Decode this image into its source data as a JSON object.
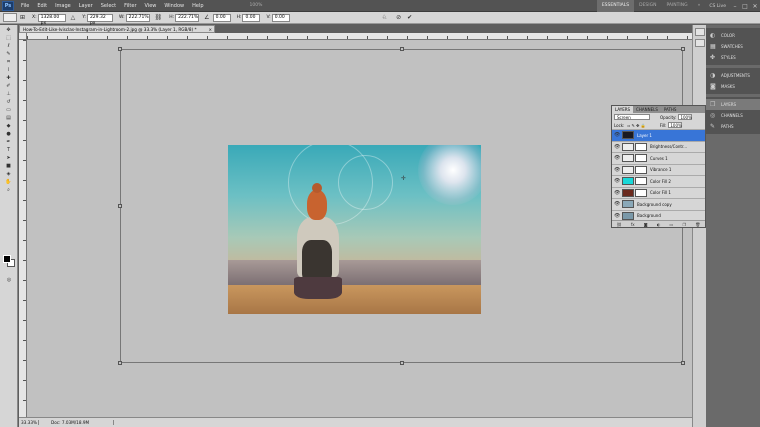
{
  "menu": {
    "logo": "Ps",
    "items": [
      "File",
      "Edit",
      "Image",
      "Layer",
      "Select",
      "Filter",
      "View",
      "Window",
      "Help"
    ],
    "zoom_readout": "100%",
    "workspaces": [
      "ESSENTIALS",
      "DESIGN",
      "PAINTING"
    ],
    "more": "»",
    "cs_live": "CS Live",
    "win_min": "–",
    "win_max": "□",
    "win_close": "✕"
  },
  "options": {
    "x_label": "X:",
    "x_value": "1328.00 px",
    "y_label": "Y:",
    "y_value": "229.32 px",
    "w_label": "W:",
    "w_value": "222.71%",
    "h_label": "H:",
    "h_value": "222.71%",
    "angle_value": "0.00",
    "hskew_label": "H:",
    "hskew_value": "0.00",
    "vskew_label": "V:",
    "vskew_value": "0.00"
  },
  "document": {
    "tab_title": "How-To-Edit-Like-Ivisclas-Instagram-in-Lightroom-2.jpg @ 33.3% (Layer 1, RGB/8) *",
    "close": "×"
  },
  "status": {
    "zoom": "33.33%",
    "doc_size": "Doc: 7.03M/18.9M"
  },
  "layers_panel": {
    "tabs": [
      "LAYERS",
      "CHANNELS",
      "PATHS"
    ],
    "blend_mode": "Screen",
    "opacity_label": "Opacity:",
    "opacity": "100%",
    "lock_label": "Lock:",
    "fill_label": "Fill:",
    "fill": "100%",
    "layers": [
      {
        "name": "Layer 1",
        "selected": true,
        "thumb": "#1a1a22",
        "mask": false
      },
      {
        "name": "Brightness/Contr...",
        "selected": false,
        "thumb": "#eeeeee",
        "mask": true
      },
      {
        "name": "Curves 1",
        "selected": false,
        "thumb": "#eeeeee",
        "mask": true
      },
      {
        "name": "Vibrance 1",
        "selected": false,
        "thumb": "#eeeeee",
        "mask": true
      },
      {
        "name": "Color Fill 2",
        "selected": false,
        "thumb": "#19d9d9",
        "mask": true
      },
      {
        "name": "Color Fill 1",
        "selected": false,
        "thumb": "#6b2a1e",
        "mask": true
      },
      {
        "name": "Background copy",
        "selected": false,
        "thumb": "#8aa8b8",
        "mask": false
      },
      {
        "name": "Background",
        "selected": false,
        "thumb": "#7a98a8",
        "mask": false
      }
    ]
  },
  "right_panels": {
    "group1": [
      "COLOR",
      "SWATCHES",
      "STYLES"
    ],
    "group2": [
      "ADJUSTMENTS",
      "MASKS"
    ],
    "group3": [
      "LAYERS",
      "CHANNELS",
      "PATHS"
    ]
  }
}
